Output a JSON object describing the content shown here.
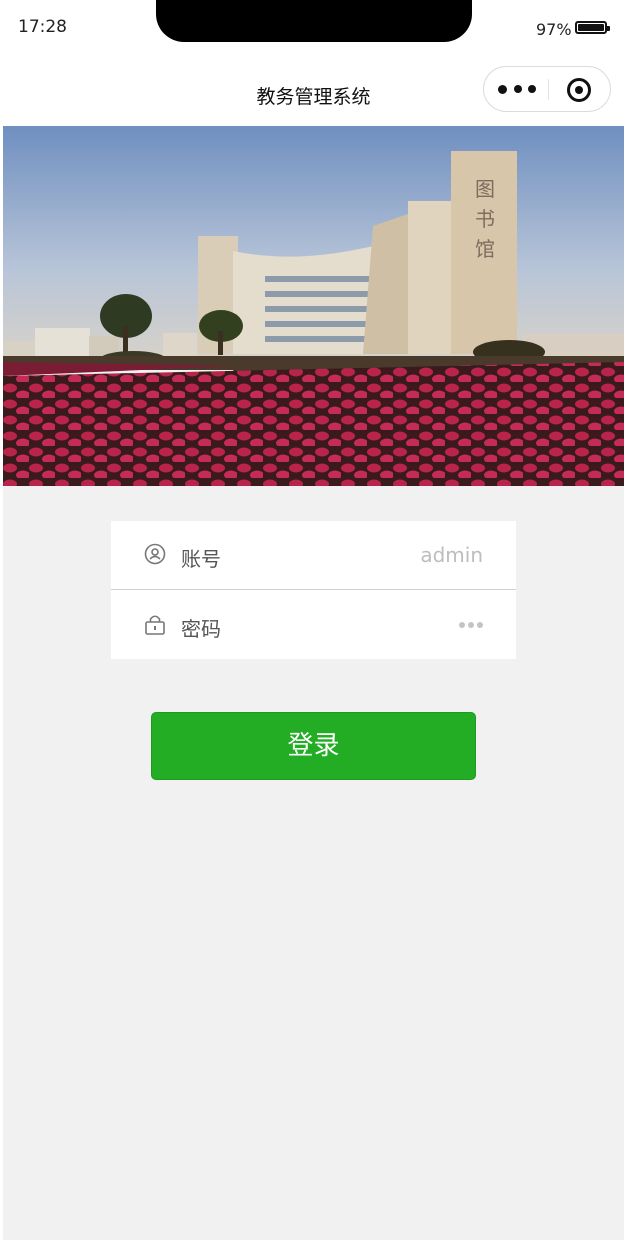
{
  "status_bar": {
    "time": "17:28",
    "battery_percent": "97%",
    "battery_level": 0.97
  },
  "nav": {
    "title": "教务管理系统"
  },
  "capsule": {
    "more_icon": "more-dots-icon",
    "close_icon": "target-close-icon"
  },
  "banner": {
    "image": "campus-library-photo"
  },
  "form": {
    "account_label": "账号",
    "account_placeholder": "admin",
    "password_label": "密码",
    "password_placeholder": "•••",
    "account_icon": "user-icon",
    "password_icon": "lock-icon"
  },
  "login": {
    "label": "登录",
    "color": "#22ad24"
  }
}
